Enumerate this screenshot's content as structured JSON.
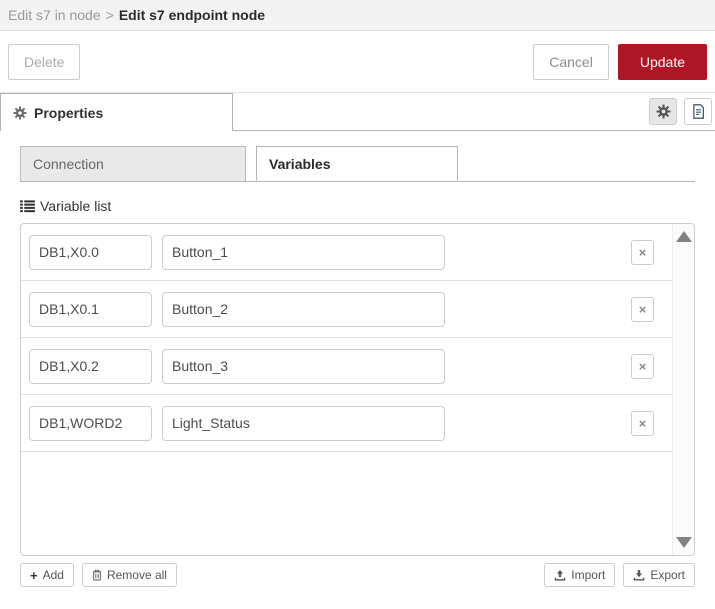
{
  "breadcrumb": {
    "parent": "Edit s7 in node",
    "separator": ">",
    "current": "Edit s7 endpoint node"
  },
  "toolbar": {
    "delete": "Delete",
    "cancel": "Cancel",
    "update": "Update"
  },
  "properties_tab": {
    "label": "Properties"
  },
  "tabs": {
    "connection": "Connection",
    "variables": "Variables"
  },
  "variable_list": {
    "label": "Variable list",
    "row_delete_glyph": "×",
    "rows": [
      {
        "address": "DB1,X0.0",
        "name": "Button_1"
      },
      {
        "address": "DB1,X0.1",
        "name": "Button_2"
      },
      {
        "address": "DB1,X0.2",
        "name": "Button_3"
      },
      {
        "address": "DB1,WORD2",
        "name": "Light_Status"
      }
    ]
  },
  "footer_actions": {
    "add_glyph": "+",
    "add": "Add",
    "remove_all": "Remove all",
    "import": "Import",
    "export": "Export"
  },
  "icons": {
    "properties_tab": "gear-icon",
    "settings_button": "gear-icon",
    "description_button": "file-text-icon",
    "variable_list": "list-icon",
    "add": "plus-icon",
    "remove_all": "trash-icon",
    "import": "upload-icon",
    "export": "download-icon",
    "row_delete": "close-icon",
    "scroll_up": "triangle-up-icon",
    "scroll_down": "triangle-down-icon"
  },
  "colors": {
    "accent_red": "#AD1625",
    "header_bg": "#f3f3f3",
    "tab_inactive_bg": "#e9e9e9",
    "border": "#cccccc"
  }
}
